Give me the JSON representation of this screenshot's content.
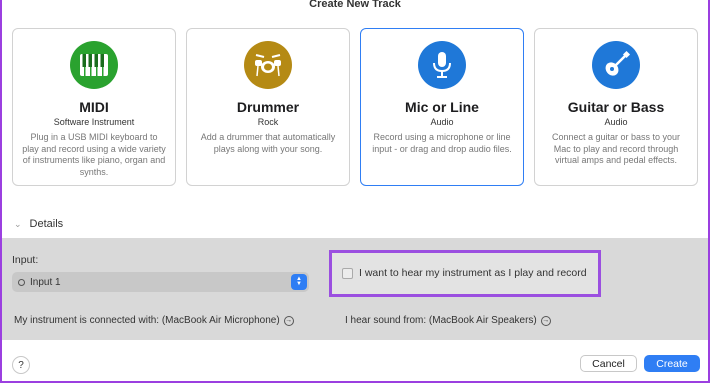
{
  "dialog": {
    "title": "Create New Track"
  },
  "colors": {
    "accent": "#2f7ef4",
    "midi": "#2aa22f",
    "drummer": "#b58a14",
    "mic": "#1f78d8",
    "guitar": "#1f78d8",
    "highlight": "#9b4fe0"
  },
  "cards": [
    {
      "name": "MIDI",
      "sub": "Software Instrument",
      "desc": "Plug in a USB MIDI keyboard to play and record using a wide variety of instruments like piano, organ and synths.",
      "icon": "piano-keys-icon"
    },
    {
      "name": "Drummer",
      "sub": "Rock",
      "desc": "Add a drummer that automatically plays along with your song.",
      "icon": "drum-kit-icon"
    },
    {
      "name": "Mic or Line",
      "sub": "Audio",
      "desc": "Record using a microphone or line input - or drag and drop audio files.",
      "icon": "microphone-icon",
      "selected": true
    },
    {
      "name": "Guitar or Bass",
      "sub": "Audio",
      "desc": "Connect a guitar or bass to your Mac to play and record through virtual amps and pedal effects.",
      "icon": "guitar-icon"
    }
  ],
  "details": {
    "label": "Details",
    "input_label": "Input:",
    "input_value": "Input 1",
    "monitor_checkbox_label": "I want to hear my instrument as I play and record",
    "monitor_checked": false,
    "connected_with": "My instrument is connected with: (MacBook Air Microphone)",
    "hear_from": "I hear sound from: (MacBook Air Speakers)"
  },
  "footer": {
    "help": "?",
    "cancel": "Cancel",
    "create": "Create"
  }
}
